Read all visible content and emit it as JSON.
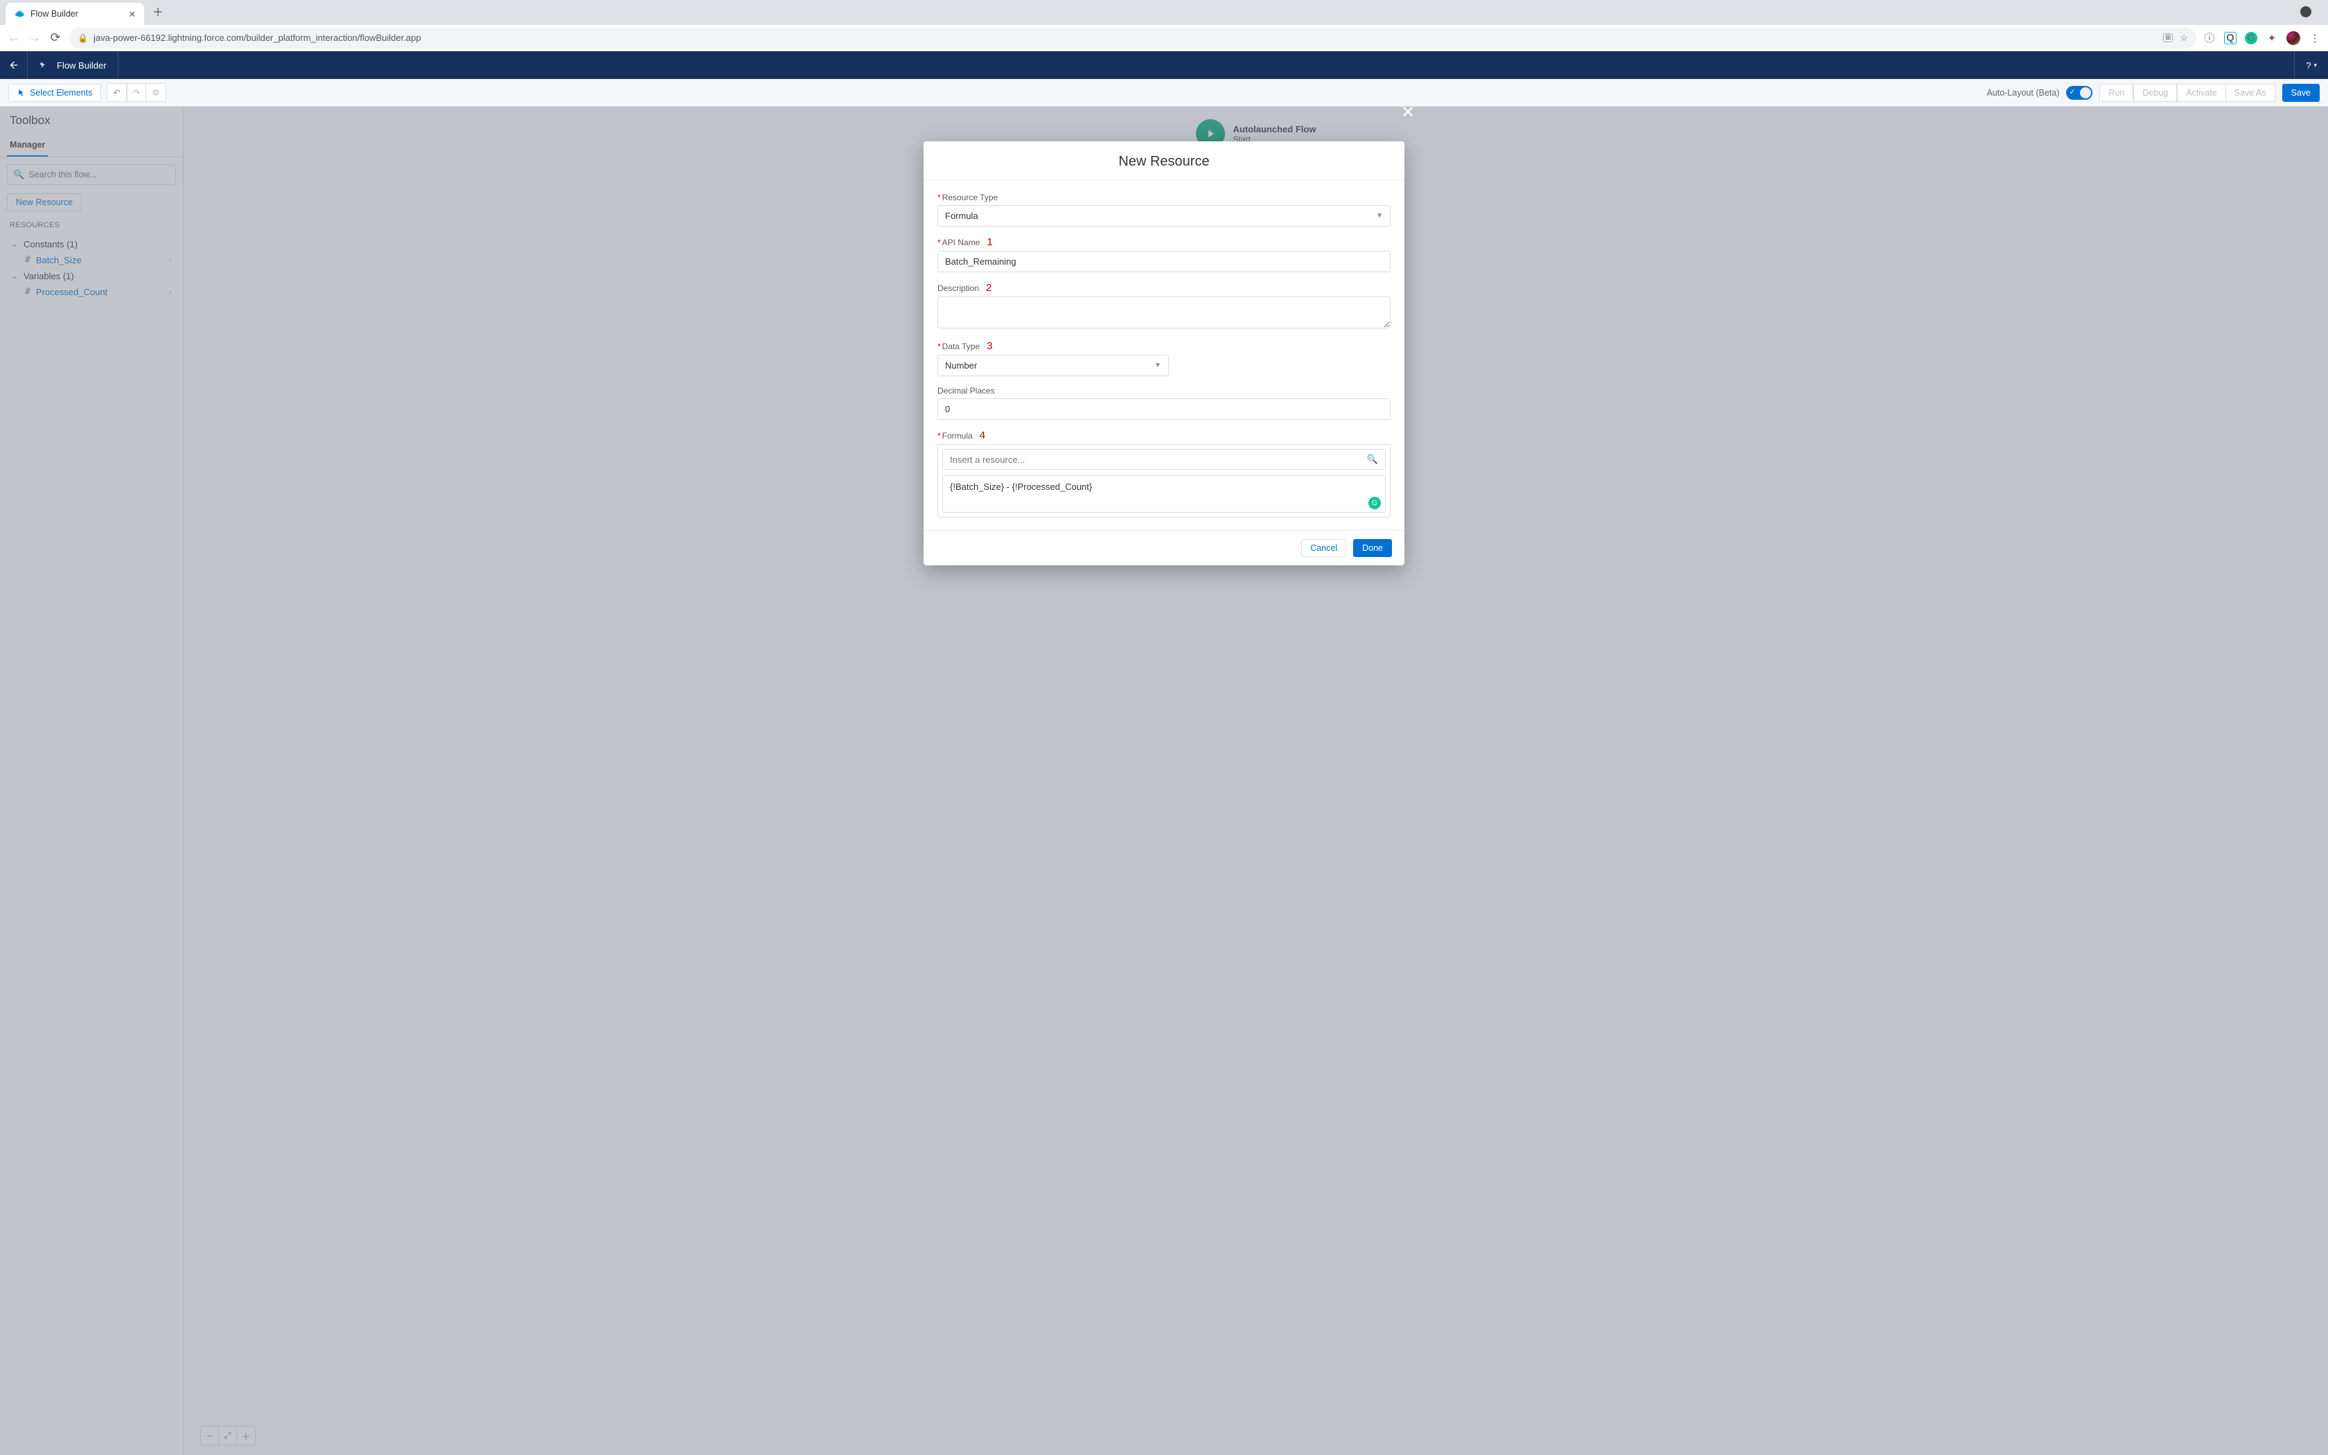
{
  "browser": {
    "tab_title": "Flow Builder",
    "url": "java-power-66192.lightning.force.com/builder_platform_interaction/flowBuilder.app"
  },
  "header": {
    "app_title": "Flow Builder",
    "help_label": "?"
  },
  "toolbar": {
    "select_label": "Select Elements",
    "autolayout_label": "Auto-Layout (Beta)",
    "run_label": "Run",
    "debug_label": "Debug",
    "activate_label": "Activate",
    "saveas_label": "Save As",
    "save_label": "Save"
  },
  "sidebar": {
    "title": "Toolbox",
    "tab_label": "Manager",
    "search_placeholder": "Search this flow...",
    "new_resource_label": "New Resource",
    "resources_heading": "RESOURCES",
    "groups": [
      {
        "label": "Constants (1)"
      },
      {
        "label": "Variables (1)"
      }
    ],
    "items": [
      {
        "label": "Batch_Size"
      },
      {
        "label": "Processed_Count"
      }
    ]
  },
  "canvas": {
    "start_title": "Autolaunched Flow",
    "start_sub": "Start"
  },
  "modal": {
    "title": "New Resource",
    "labels": {
      "resource_type": "Resource Type",
      "api_name": "API Name",
      "description": "Description",
      "data_type": "Data Type",
      "decimal_places": "Decimal Places",
      "formula": "Formula"
    },
    "annotations": {
      "a1": "1",
      "a2": "2",
      "a3": "3",
      "a4": "4"
    },
    "values": {
      "resource_type": "Formula",
      "api_name": "Batch_Remaining",
      "description": "",
      "data_type": "Number",
      "decimal_places": "0",
      "resource_insert_placeholder": "Insert a resource...",
      "formula": "{!Batch_Size} - {!Processed_Count}"
    },
    "buttons": {
      "cancel": "Cancel",
      "done": "Done"
    }
  }
}
